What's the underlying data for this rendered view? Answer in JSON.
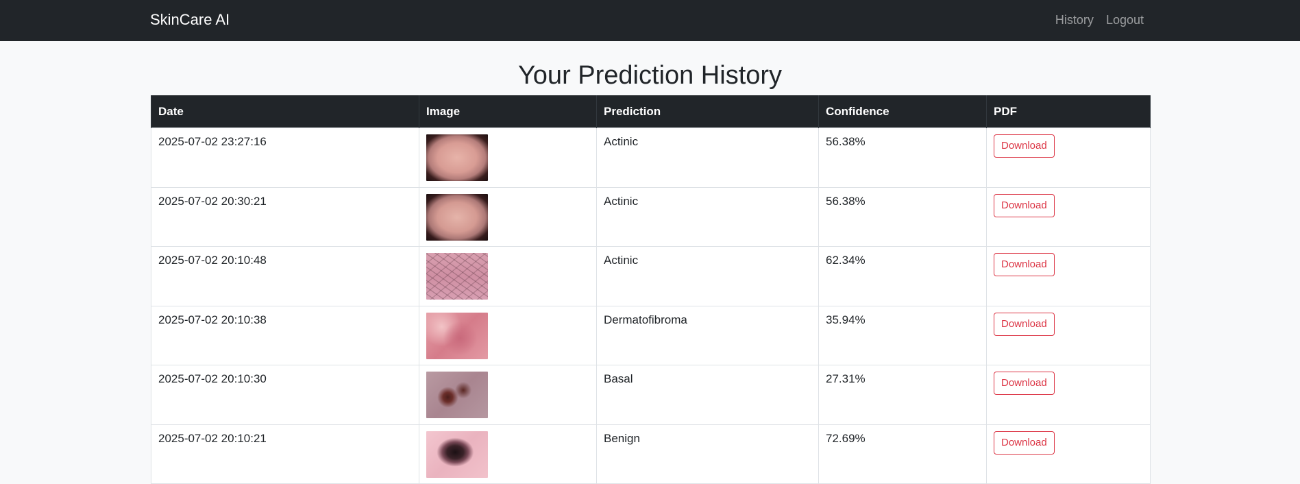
{
  "navbar": {
    "brand": "SkinCare AI",
    "links": [
      "History",
      "Logout"
    ]
  },
  "page": {
    "title": "Your Prediction History"
  },
  "table": {
    "headers": [
      "Date",
      "Image",
      "Prediction",
      "Confidence",
      "PDF"
    ],
    "rows": [
      {
        "date": "2025-07-02 23:27:16",
        "prediction": "Actinic",
        "confidence": "56.38%",
        "pdf_label": "Download"
      },
      {
        "date": "2025-07-02 20:30:21",
        "prediction": "Actinic",
        "confidence": "56.38%",
        "pdf_label": "Download"
      },
      {
        "date": "2025-07-02 20:10:48",
        "prediction": "Actinic",
        "confidence": "62.34%",
        "pdf_label": "Download"
      },
      {
        "date": "2025-07-02 20:10:38",
        "prediction": "Dermatofibroma",
        "confidence": "35.94%",
        "pdf_label": "Download"
      },
      {
        "date": "2025-07-02 20:10:30",
        "prediction": "Basal",
        "confidence": "27.31%",
        "pdf_label": "Download"
      },
      {
        "date": "2025-07-02 20:10:21",
        "prediction": "Benign",
        "confidence": "72.69%",
        "pdf_label": "Download"
      }
    ]
  }
}
